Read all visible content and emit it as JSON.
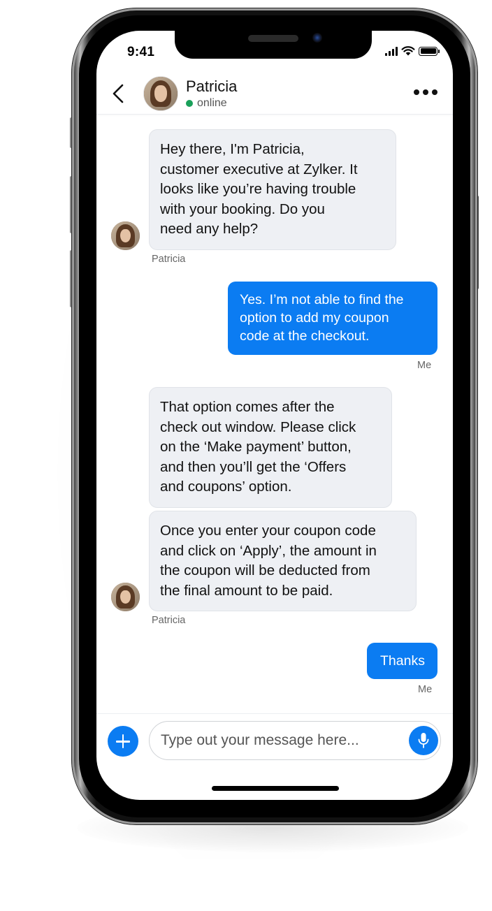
{
  "status_bar": {
    "time": "9:41",
    "icons": [
      "cellular-signal-icon",
      "wifi-icon",
      "battery-icon"
    ]
  },
  "header": {
    "back_icon": "chevron-left-icon",
    "contact_name": "Patricia",
    "contact_status": "online",
    "status_color": "#1aa05a",
    "more_icon": "more-horizontal-icon"
  },
  "messages": [
    {
      "direction": "incoming",
      "sender": "Patricia",
      "lines": [
        "Hey there, I'm Patricia,",
        "customer executive at Zylker. It",
        "looks like you’re having trouble",
        "with your booking. Do you",
        "need any help?"
      ]
    },
    {
      "direction": "outgoing",
      "sender": "Me",
      "lines": [
        "Yes. I’m not able to find the",
        "option to add my coupon",
        "code at the checkout."
      ]
    },
    {
      "direction": "incoming",
      "sender": "",
      "lines": [
        "That option comes after the",
        "check out window. Please click",
        "on the ‘Make payment’ button,",
        "and then you’ll get the ‘Offers",
        "and coupons’ option."
      ]
    },
    {
      "direction": "incoming",
      "sender": "Patricia",
      "lines": [
        "Once you enter your coupon code",
        "and click on ‘Apply’, the amount in",
        "the coupon will be deducted from",
        "the final amount to be paid."
      ]
    },
    {
      "direction": "outgoing",
      "sender": "Me",
      "lines": [
        "Thanks"
      ]
    }
  ],
  "composer": {
    "add_icon": "plus-icon",
    "placeholder": "Type out your message here...",
    "value": "",
    "mic_icon": "microphone-icon"
  },
  "colors": {
    "accent": "#0b7cf2",
    "incoming_bubble": "#eef0f4",
    "outgoing_text": "#ffffff"
  }
}
